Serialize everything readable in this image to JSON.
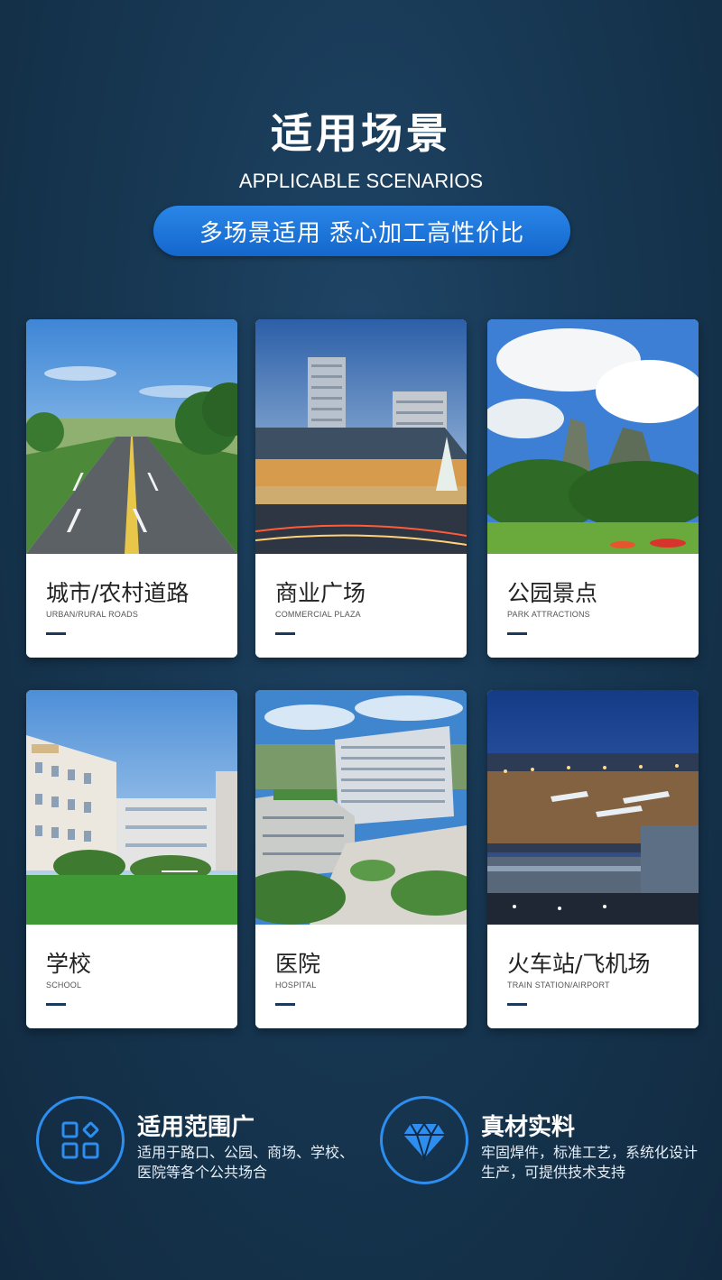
{
  "header": {
    "title_cn": "适用场景",
    "title_en": "APPLICABLE SCENARIOS",
    "tagline": "多场景适用 悉心加工高性价比"
  },
  "scenarios": [
    {
      "title": "城市/农村道路",
      "subtitle": "URBAN/RURAL ROADS",
      "photo_icon": "road-photo"
    },
    {
      "title": "商业广场",
      "subtitle": "COMMERCIAL PLAZA",
      "photo_icon": "plaza-photo"
    },
    {
      "title": "公园景点",
      "subtitle": "PARK ATTRACTIONS",
      "photo_icon": "park-photo"
    },
    {
      "title": "学校",
      "subtitle": "SCHOOL",
      "photo_icon": "school-photo"
    },
    {
      "title": "医院",
      "subtitle": "HOSPITAL",
      "photo_icon": "hospital-photo"
    },
    {
      "title": "火车站/飞机场",
      "subtitle": "TRAIN STATION/AIRPORT",
      "photo_icon": "airport-photo"
    }
  ],
  "features": [
    {
      "title": "适用范围广",
      "desc": "适用于路口、公园、商场、学校、医院等各个公共场合",
      "icon": "grid-icon"
    },
    {
      "title": "真材实料",
      "desc": "牢固焊件，标准工艺，系统化设计生产，可提供技术支持",
      "icon": "diamond-icon"
    }
  ],
  "colors": {
    "background": "#173752",
    "accent": "#1e78de",
    "icon_ring": "#2d8ef0",
    "dash": "#1a3a5c"
  }
}
